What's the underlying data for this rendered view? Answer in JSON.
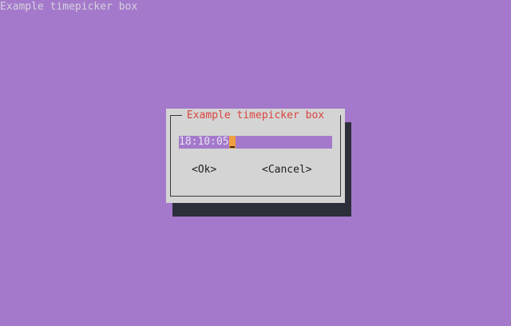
{
  "backtitle": "Example timepicker box",
  "dialog": {
    "title": "Example timepicker box",
    "time_value": "18:10:05",
    "ok_label": "<Ok>",
    "cancel_label": "<Cancel>"
  },
  "colors": {
    "background": "#a479cb",
    "dialog": "#d4d4d4",
    "title": "#d8453f",
    "shadow": "#2c2e3a",
    "cursor": "#f0a040"
  }
}
